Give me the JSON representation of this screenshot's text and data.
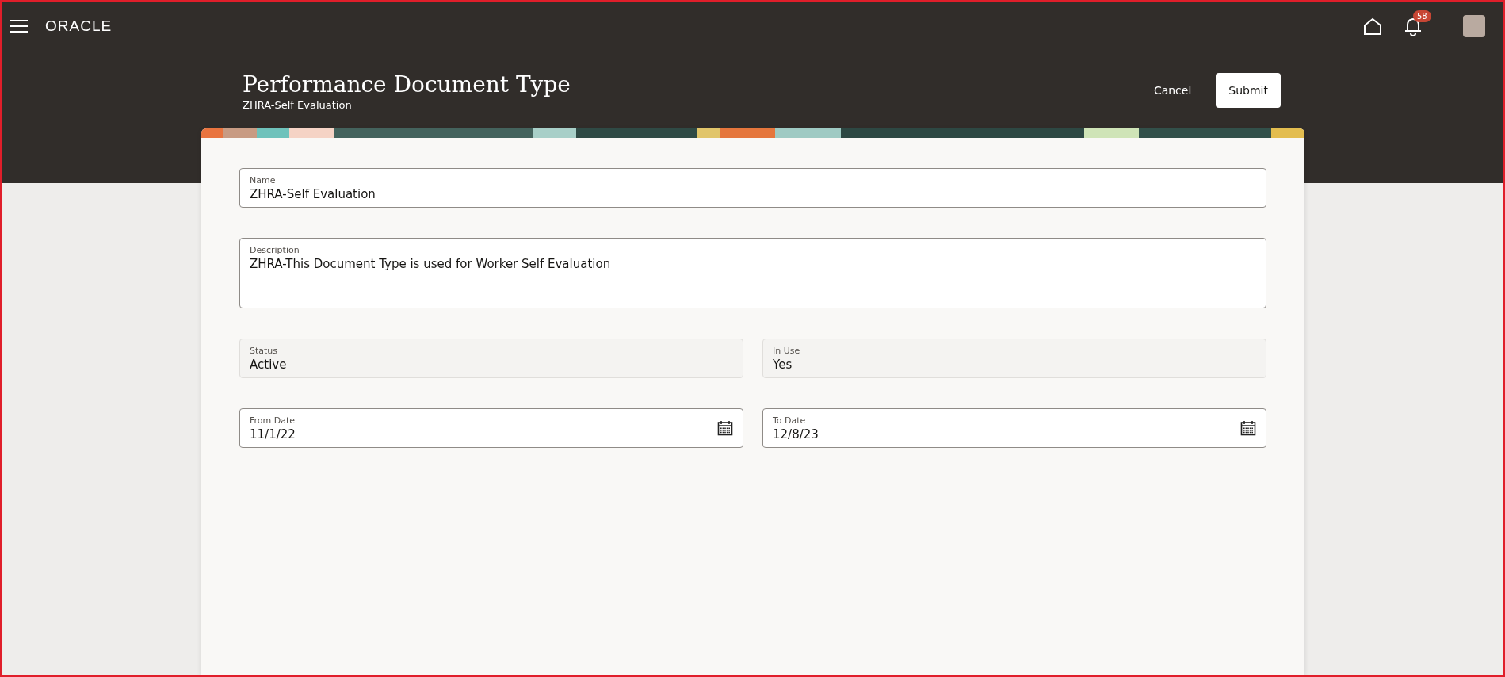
{
  "top_bar": {
    "logo": "ORACLE",
    "notifications": {
      "count": "58"
    }
  },
  "header": {
    "title": "Performance Document Type",
    "subtitle": "ZHRA-Self Evaluation",
    "buttons": [
      {
        "label": "Cancel",
        "kind": "text"
      },
      {
        "label": "Submit",
        "kind": "solid"
      }
    ]
  },
  "form": {
    "rows": [
      [
        {
          "label": "Name",
          "value": "ZHRA-Self Evaluation",
          "kind": "text"
        }
      ],
      [
        {
          "label": "Description",
          "value": "ZHRA-This Document Type is used for Worker Self Evaluation",
          "kind": "textarea"
        }
      ],
      [
        {
          "label": "Status",
          "value": "Active",
          "kind": "readonly"
        },
        {
          "label": "In Use",
          "value": "Yes",
          "kind": "readonly"
        }
      ],
      [
        {
          "label": "From Date",
          "value": "11/1/22",
          "kind": "date"
        },
        {
          "label": "To Date",
          "value": "12/8/23",
          "kind": "date"
        }
      ]
    ]
  }
}
